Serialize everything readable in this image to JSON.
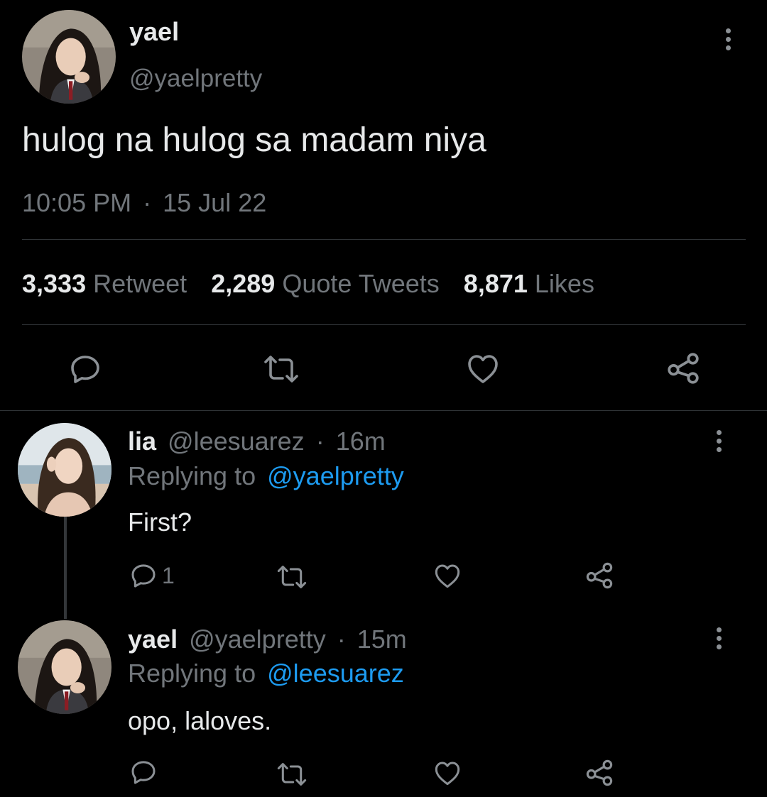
{
  "main_tweet": {
    "display_name": "yael",
    "handle": "@yaelpretty",
    "text": "hulog na hulog sa madam niya",
    "time": "10:05 PM",
    "separator": "·",
    "date": "15 Jul 22",
    "stats": {
      "retweets_count": "3,333",
      "retweets_label": "Retweet",
      "quotes_count": "2,289",
      "quotes_label": "Quote Tweets",
      "likes_count": "8,871",
      "likes_label": "Likes"
    }
  },
  "replies": [
    {
      "display_name": "lia",
      "handle": "@leesuarez",
      "separator": "·",
      "time": "16m",
      "replying_prefix": "Replying to",
      "replying_to": "@yaelpretty",
      "text": "First?",
      "reply_count": "1"
    },
    {
      "display_name": "yael",
      "handle": "@yaelpretty",
      "separator": "·",
      "time": "15m",
      "replying_prefix": "Replying to",
      "replying_to": "@leesuarez",
      "text": "opo, laloves.",
      "reply_count": ""
    }
  ],
  "icons": [
    "reply-icon",
    "retweet-icon",
    "like-icon",
    "share-icon",
    "more-icon"
  ],
  "colors": {
    "background": "#000000",
    "text": "#e7e9ea",
    "muted": "#71767b",
    "link": "#1d9bf0",
    "divider": "#2f3336"
  }
}
